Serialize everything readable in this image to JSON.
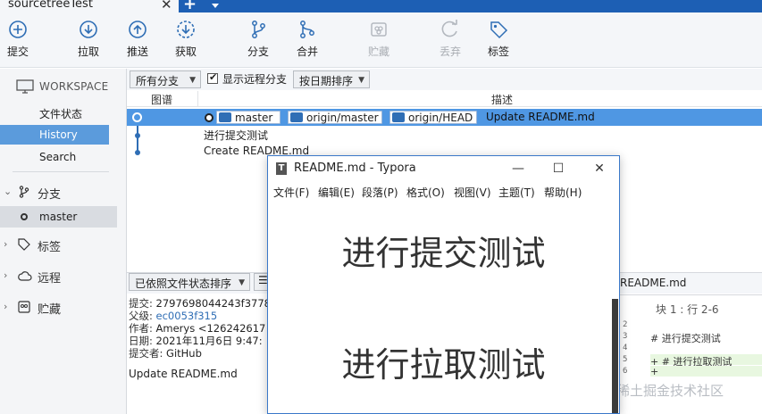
{
  "tab": {
    "title": "sourcetreeTest",
    "close": "✕",
    "add": "+"
  },
  "toolbar": {
    "commit": "提交",
    "pull": "拉取",
    "push": "推送",
    "fetch": "获取",
    "branch": "分支",
    "merge": "合并",
    "stash": "贮藏",
    "discard": "丢弃",
    "tag": "标签"
  },
  "sidebar": {
    "workspace": "WORKSPACE",
    "items": [
      "文件状态",
      "History",
      "Search"
    ],
    "groups": {
      "branches": "分支",
      "tags": "标签",
      "remotes": "远程",
      "stashes": "贮藏"
    },
    "branch_master": "master"
  },
  "filters": {
    "branches": "所有分支",
    "show_remote": "显示远程分支",
    "sort": "按日期排序"
  },
  "columns": {
    "graph": "图谱",
    "description": "描述"
  },
  "commits": {
    "refs": [
      "master",
      "origin/master",
      "origin/HEAD"
    ],
    "selected_message": "Update README.md",
    "rows": [
      "进行提交测试",
      "Create README.md"
    ]
  },
  "details": {
    "sort_dropdown": "已依照文件状态排序",
    "commit_label": "提交:",
    "commit_value": "2797698044243f3778",
    "parent_label": "父级:",
    "parent_value": "ec0053f315",
    "author_label": "作者:",
    "author_value": "Amerys <126242617",
    "date_label": "日期:",
    "date_value": "2021年11月6日 9:47:",
    "committer_label": "提交者:",
    "committer_value": "GitHub",
    "message": "Update README.md"
  },
  "diff": {
    "file": "README.md",
    "hunk": "块 1 : 行 2-6",
    "lines": [
      {
        "n": "2",
        "text": ""
      },
      {
        "n": "3",
        "text": "  # 进行提交测试"
      },
      {
        "n": "4",
        "text": ""
      },
      {
        "n": "5",
        "text": "+ # 进行拉取测试"
      },
      {
        "n": "6",
        "text": "+"
      }
    ]
  },
  "watermark": "@稀土掘金技术社区",
  "typora": {
    "title": "README.md - Typora",
    "menu": [
      "文件(F)",
      "编辑(E)",
      "段落(P)",
      "格式(O)",
      "视图(V)",
      "主题(T)",
      "帮助(H)"
    ],
    "heading1": "进行提交测试",
    "heading2": "进行拉取测试"
  },
  "colors": {
    "accent": "#1d5fb4",
    "selection": "#4f97e3",
    "sidebar_selected": "#5b9bdc"
  }
}
